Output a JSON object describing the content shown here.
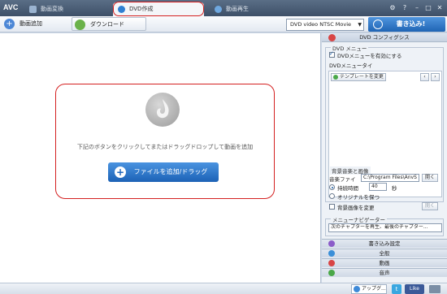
{
  "app": {
    "logo": "AVC"
  },
  "tabs": [
    {
      "label": "動画変換"
    },
    {
      "label": "DVD作成"
    },
    {
      "label": "動画再生"
    }
  ],
  "window_buttons": [
    "⚙",
    "?",
    "–",
    "□",
    "✕"
  ],
  "toolbar": {
    "add_video": "動画追加",
    "download": "ダウンロード",
    "format": "DVD video NTSC Movie",
    "burn": "書き込み!"
  },
  "main": {
    "hint": "下記のボタンをクリックしてまたはドラッグドロップして動画を追加",
    "add_button": "ファイルを追加/ドラッグ"
  },
  "panel": {
    "header": "DVD コンフィグシス",
    "dvd_menu": {
      "title": "DVD メニュー",
      "enable": "DVDメニューを有効にする",
      "enabled": true,
      "menu_title": "DVDメニュータイ",
      "change_template": "テンプレートを変更"
    },
    "bg": {
      "title": "背景音楽と画像",
      "music_file_label": "音楽ファイ",
      "music_file_value": "C:\\Program Files\\AnvS",
      "open": "開く",
      "duration_label": "持続時間",
      "duration_value": "40",
      "seconds": "秒",
      "keep_original": "オリジナルを保つ",
      "change_bg": "背景画像を変更",
      "open2": "開く"
    },
    "navigator": {
      "title": "メニューナビゲーター",
      "value": "次のチャプターを再生、最後のチャプター..."
    },
    "sections": [
      {
        "label": "書き込み設定",
        "color": "#8b5cc9"
      },
      {
        "label": "全般",
        "color": "#3b8fd8"
      },
      {
        "label": "動画",
        "color": "#d84545"
      },
      {
        "label": "音声",
        "color": "#4aa848"
      }
    ]
  },
  "status": {
    "upgrade": "アップグ...",
    "facebook": "Like"
  }
}
